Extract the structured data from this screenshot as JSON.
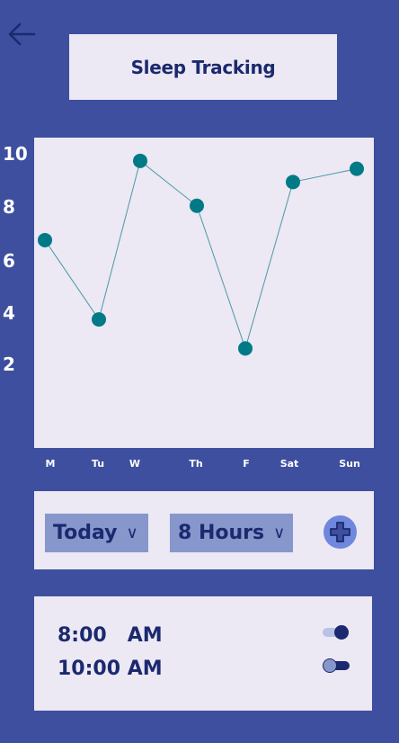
{
  "header": {
    "back_icon": "arrow-left-icon",
    "title": "Sleep Tracking"
  },
  "chart_data": {
    "type": "line",
    "categories": [
      "M",
      "Tu",
      "W",
      "Th",
      "F",
      "Sat",
      "Sun"
    ],
    "values": [
      6.7,
      3.7,
      9.7,
      8.0,
      2.6,
      8.9,
      9.4
    ],
    "yticks": [
      2,
      4,
      6,
      8,
      10
    ],
    "ylim": [
      0,
      11
    ],
    "grid": false,
    "title": "",
    "xlabel": "",
    "ylabel": "",
    "colors": {
      "point": "#007a87",
      "line": "#4a9aa4"
    }
  },
  "selector": {
    "day": {
      "label": "Today",
      "chevron": "∨"
    },
    "duration": {
      "label": "8 Hours",
      "chevron": "∨"
    },
    "add_icon": "plus-circle-icon"
  },
  "alarms": [
    {
      "time": "8:00   AM",
      "enabled": true
    },
    {
      "time": "10:00 AM",
      "enabled": false
    }
  ],
  "colors": {
    "background": "#3d4f9e",
    "card": "#ece8f4",
    "text": "#1b2a6e",
    "accent": "#6f87dc"
  }
}
